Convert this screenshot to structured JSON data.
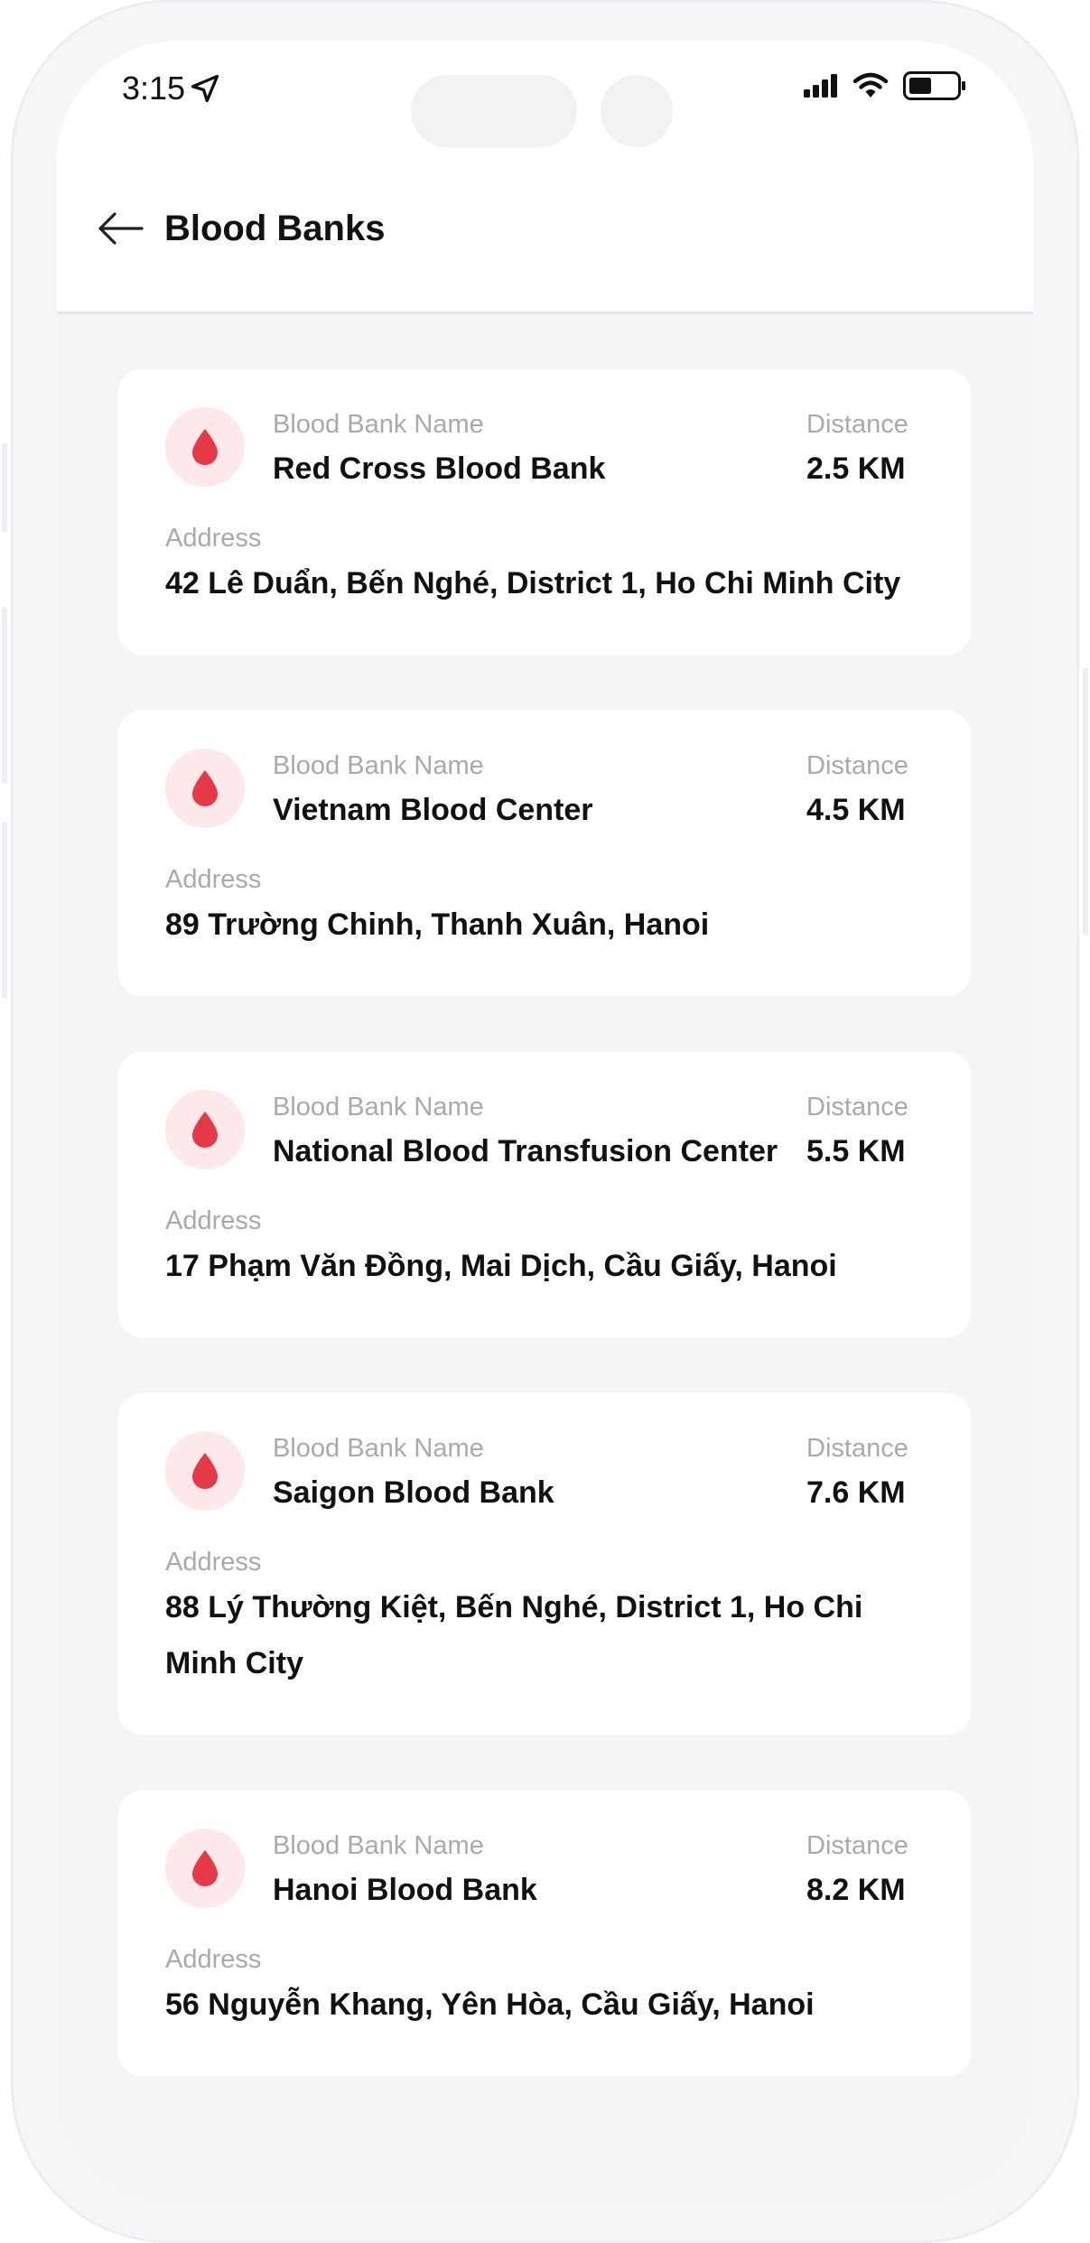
{
  "status_bar": {
    "time": "3:15"
  },
  "header": {
    "title": "Blood Banks"
  },
  "labels": {
    "name": "Blood Bank Name",
    "distance": "Distance",
    "address": "Address"
  },
  "banks": [
    {
      "name": "Red Cross Blood Bank",
      "distance": "2.5 KM",
      "address": "42 Lê Duẩn, Bến Nghé, District 1, Ho Chi Minh City"
    },
    {
      "name": "Vietnam Blood Center",
      "distance": "4.5 KM",
      "address": "89 Trường Chinh, Thanh Xuân, Hanoi"
    },
    {
      "name": "National Blood Transfusion Center",
      "distance": "5.5 KM",
      "address": "17 Phạm Văn Đồng, Mai Dịch, Cầu Giấy, Hanoi"
    },
    {
      "name": "Saigon Blood Bank",
      "distance": "7.6 KM",
      "address": "88 Lý Thường Kiệt, Bến Nghé, District 1, Ho Chi Minh City"
    },
    {
      "name": "Hanoi Blood Bank",
      "distance": "8.2 KM",
      "address": "56 Nguyễn Khang, Yên Hòa, Cầu Giấy, Hanoi"
    }
  ],
  "colors": {
    "accent": "#e63946",
    "accent_bg": "#fde8ea",
    "label": "#a9a9ae",
    "text": "#111111"
  }
}
